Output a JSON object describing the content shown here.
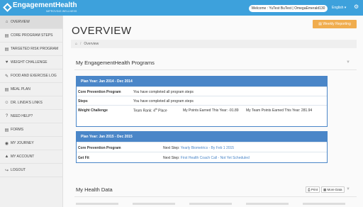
{
  "app": {
    "logo_text": "EngagementHealth",
    "logo_tagline": "IMPROVING WELLNESS",
    "welcome": "Welcome : YuTest BuTest | OmegaEmerald130",
    "language": "English",
    "language_arrow": "▾",
    "gear": "⚙"
  },
  "sidebar": {
    "items": [
      {
        "icon": "⌂",
        "label": "OVERVIEW"
      },
      {
        "icon": "▤",
        "label": "CORE PROGRAM STEPS"
      },
      {
        "icon": "▤",
        "label": "TARGETED RISK PROGRAM"
      },
      {
        "icon": "♥",
        "label": "WEIGHT CHALLENGE"
      },
      {
        "icon": "✎",
        "label": "FOOD AND EXERCISE LOG"
      },
      {
        "icon": "▤",
        "label": "MEAL PLAN"
      },
      {
        "icon": "☺",
        "label": "DR. LINDA'S LINKS"
      },
      {
        "icon": "?",
        "label": "NEED HELP?"
      },
      {
        "icon": "▤",
        "label": "FORMS"
      },
      {
        "icon": "◉",
        "label": "MY JOURNEY"
      },
      {
        "icon": "▲",
        "label": "MY ACCOUNT"
      },
      {
        "icon": "↪",
        "label": "LOGOUT"
      }
    ]
  },
  "header": {
    "title": "OVERVIEW",
    "weekly_reporting": "Weekly Reporting",
    "breadcrumb_home": "⌂",
    "breadcrumb_sep": "/",
    "breadcrumb_current": "Overview"
  },
  "programs": {
    "section_title": "My EngagementHealth Programs",
    "panels": [
      {
        "header": "Plan Year: Jan 2014 - Dec 2014",
        "rows": {
          "core_label": "Core Prevention Program",
          "core_value": "You have completed all program steps",
          "steps_label": "Steps",
          "steps_value": "You have completed all program steps",
          "weight_label": "Weight Challenge",
          "team_rank_prefix": "Team Rank: 4",
          "team_rank_sup": "th",
          "team_rank_suffix": " Place",
          "my_points": "My Points Earned This Year: -91.89",
          "team_points": "My Team Points Earned This Year: 281.94"
        }
      },
      {
        "header": "Plan Year: Jan 2015 - Dec 2015",
        "rows": {
          "core_label": "Core Prevention Program",
          "core_prefix": "Next Step: ",
          "core_link": "Yearly Biometrics - By Feb 1 2015",
          "getfit_label": "Get Fit",
          "getfit_prefix": "Next Step: ",
          "getfit_link": "First Health Coach Call - Not Yet Scheduled"
        }
      }
    ]
  },
  "health": {
    "section_title": "My Health Data",
    "print_label": "Print",
    "more_label": "More Data"
  }
}
